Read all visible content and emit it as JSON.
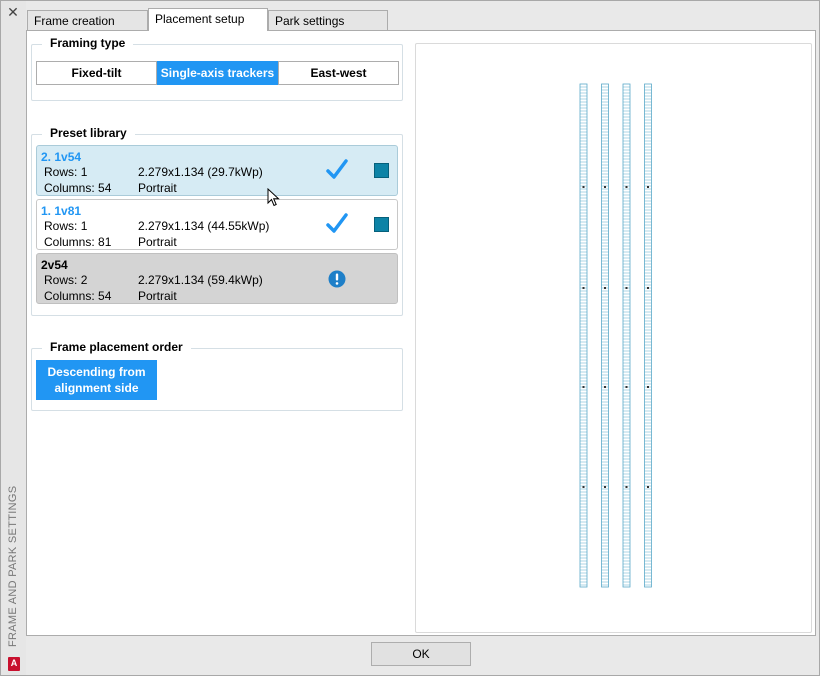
{
  "window": {
    "side_title": "FRAME AND PARK SETTINGS",
    "logo_letter": "A"
  },
  "tabs": [
    {
      "label": "Frame creation",
      "active": false
    },
    {
      "label": "Placement setup",
      "active": true
    },
    {
      "label": "Park settings",
      "active": false
    }
  ],
  "framing_type": {
    "title": "Framing type",
    "options": [
      "Fixed-tilt",
      "Single-axis trackers",
      "East-west"
    ],
    "selected": "Single-axis trackers"
  },
  "preset_library": {
    "title": "Preset library",
    "rows_label": "Rows:",
    "columns_label": "Columns:",
    "items": [
      {
        "name": "2. 1v54",
        "rows": "1",
        "columns": "54",
        "size": "2.279x1.134 (29.7kWp)",
        "orientation": "Portrait",
        "status": "valid",
        "selected": true,
        "color": "#0d83a6"
      },
      {
        "name": "1. 1v81",
        "rows": "1",
        "columns": "81",
        "size": "2.279x1.134 (44.55kWp)",
        "orientation": "Portrait",
        "status": "valid",
        "selected": false,
        "color": "#0d83a6"
      },
      {
        "name": "2v54",
        "rows": "2",
        "columns": "54",
        "size": "2.279x1.134 (59.4kWp)",
        "orientation": "Portrait",
        "status": "warning",
        "selected": false
      }
    ]
  },
  "frame_placement_order": {
    "title": "Frame placement order",
    "button_line1": "Descending from",
    "button_line2": "alignment side"
  },
  "preview": {
    "tracker_count": 4,
    "accent": "#5aa9c9"
  },
  "footer": {
    "ok_label": "OK"
  }
}
